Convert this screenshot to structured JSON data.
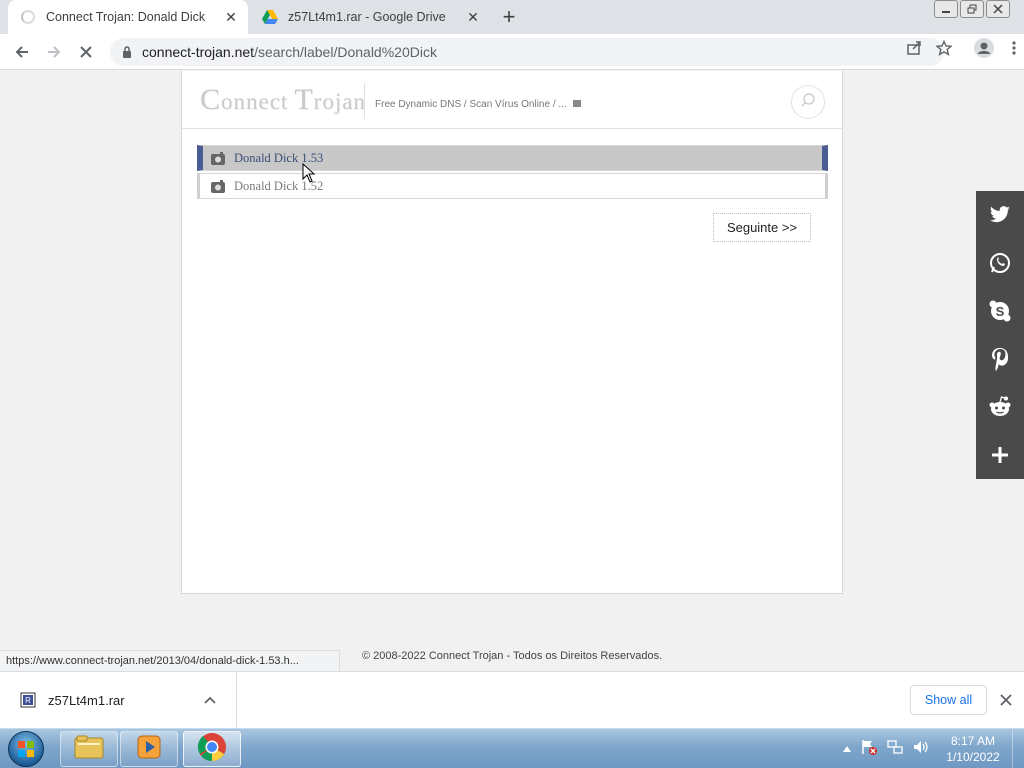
{
  "browser": {
    "tabs": [
      {
        "title": "Connect Trojan: Donald Dick",
        "icon": "loading-spinner-icon",
        "active": true
      },
      {
        "title": "z57Lt4m1.rar - Google Drive",
        "icon": "google-drive-icon",
        "active": false
      }
    ],
    "new_tab_symbol": "+",
    "close_symbol": "✕",
    "address": {
      "domain": "connect-trojan.net",
      "path": "/search/label/Donald%20Dick"
    }
  },
  "site": {
    "logo": "ConnectTrojan",
    "tagline": "Free Dynamic DNS / Scan Vírus Online / ...",
    "posts": [
      {
        "title": "Donald Dick 1.53",
        "highlighted": true
      },
      {
        "title": "Donald Dick 1.52",
        "highlighted": false
      }
    ],
    "next_label": "Seguinte >>",
    "footer": "© 2008-2022 Connect Trojan - Todos os Direitos Reservados."
  },
  "status_bar": {
    "url": "https://www.connect-trojan.net/2013/04/donald-dick-1.53.h..."
  },
  "share": [
    "twitter-icon",
    "whatsapp-icon",
    "skype-icon",
    "pinterest-icon",
    "reddit-icon",
    "plus-icon"
  ],
  "download_bar": {
    "file_name": "z57Lt4m1.rar",
    "show_all": "Show all"
  },
  "taskbar": {
    "time": "8:17 AM",
    "date": "1/10/2022"
  },
  "colors": {
    "highlight_border": "#4a5d93",
    "share_bg": "#4a4a4a",
    "link_blue": "#1a73e8"
  }
}
